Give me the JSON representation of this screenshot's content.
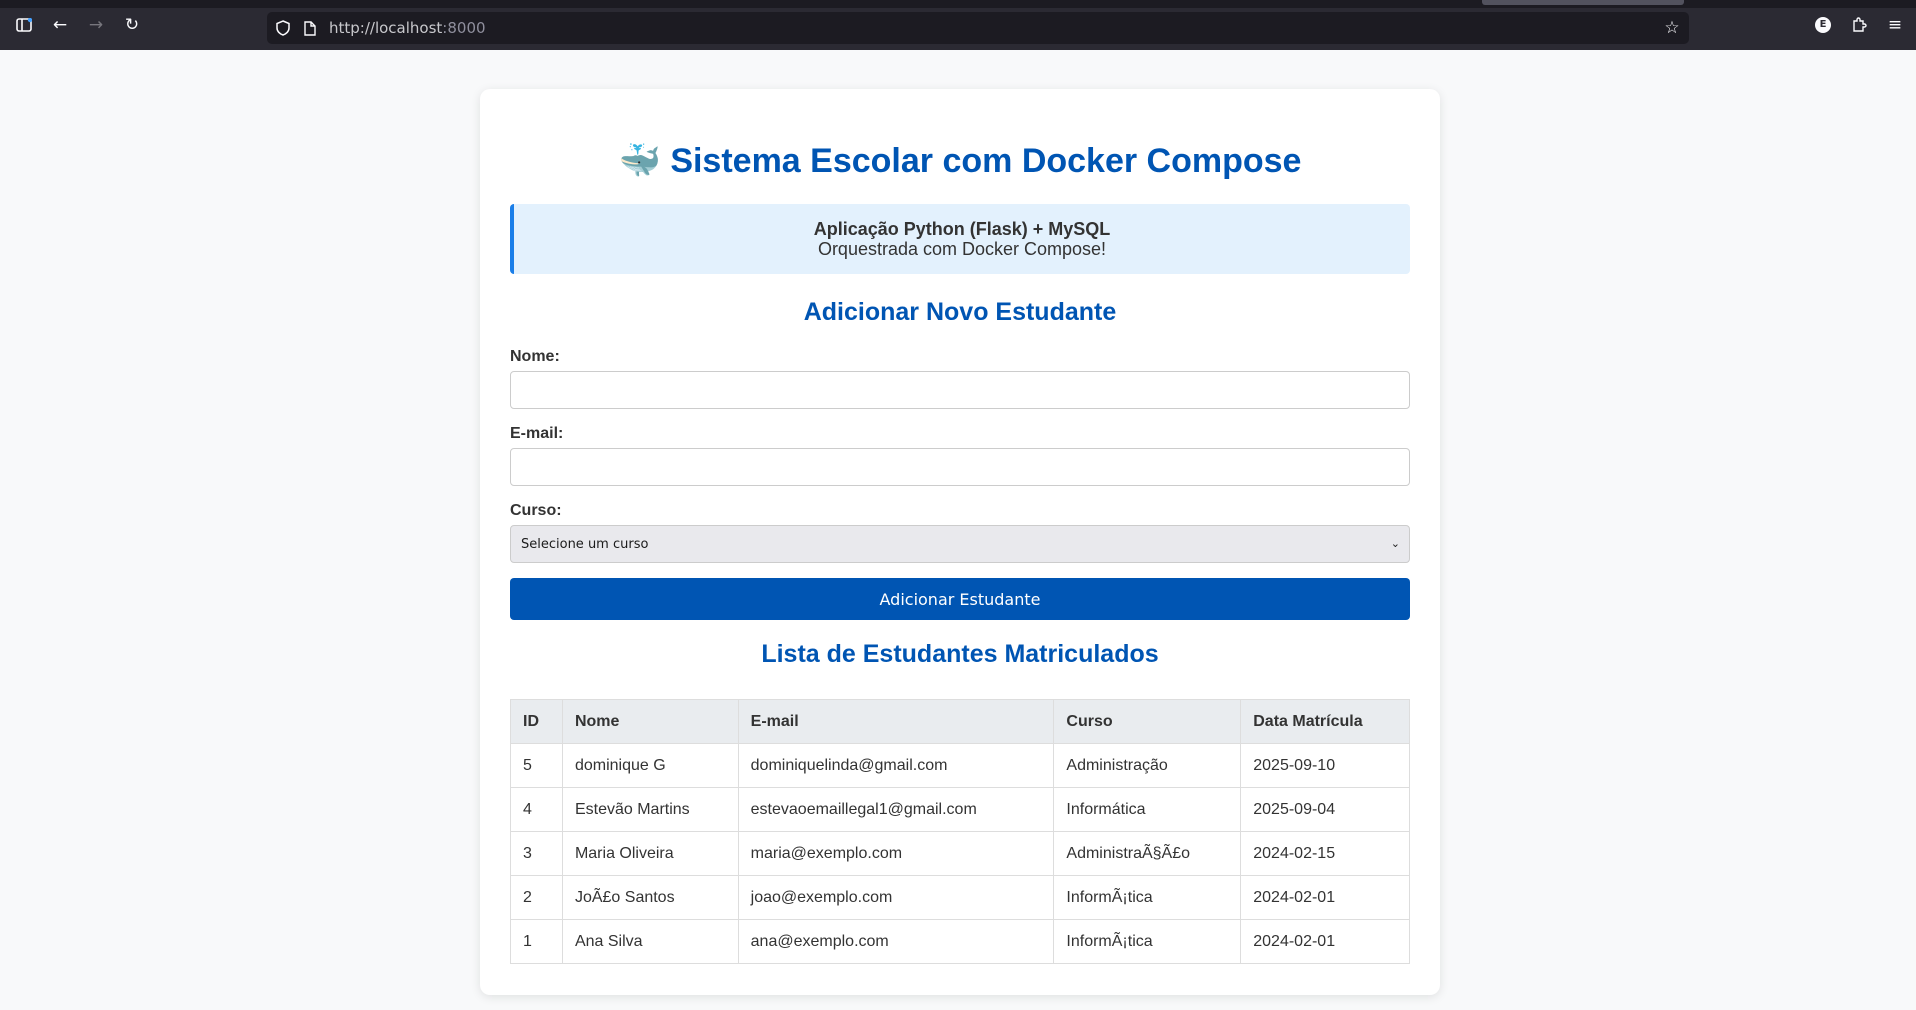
{
  "browser": {
    "url_host": "http://localhost",
    "url_port": ":8000"
  },
  "page": {
    "title_icon": "🐳",
    "title": "Sistema Escolar com Docker Compose",
    "info_line1": "Aplicação Python (Flask) + MySQL",
    "info_line2": "Orquestrada com Docker Compose!",
    "form_heading": "Adicionar Novo Estudante",
    "form": {
      "name_label": "Nome:",
      "name_value": "",
      "email_label": "E-mail:",
      "email_value": "",
      "course_label": "Curso:",
      "course_selected": "Selecione um curso",
      "submit_label": "Adicionar Estudante"
    },
    "list_heading": "Lista de Estudantes Matriculados",
    "table": {
      "headers": [
        "ID",
        "Nome",
        "E-mail",
        "Curso",
        "Data Matrícula"
      ],
      "rows": [
        [
          "5",
          "dominique G",
          "dominiquelinda@gmail.com",
          "Administração",
          "2025-09-10"
        ],
        [
          "4",
          "Estevão Martins",
          "estevaoemaillegal1@gmail.com",
          "Informática",
          "2025-09-04"
        ],
        [
          "3",
          "Maria Oliveira",
          "maria@exemplo.com",
          "AdministraÃ§Ã£o",
          "2024-02-15"
        ],
        [
          "2",
          "JoÃ£o Santos",
          "joao@exemplo.com",
          "InformÃ¡tica",
          "2024-02-01"
        ],
        [
          "1",
          "Ana Silva",
          "ana@exemplo.com",
          "InformÃ¡tica",
          "2024-02-01"
        ]
      ]
    }
  },
  "colors": {
    "accent": "#0055b3",
    "info_bg": "#e3f1fd",
    "info_border": "#1a7ee8"
  }
}
